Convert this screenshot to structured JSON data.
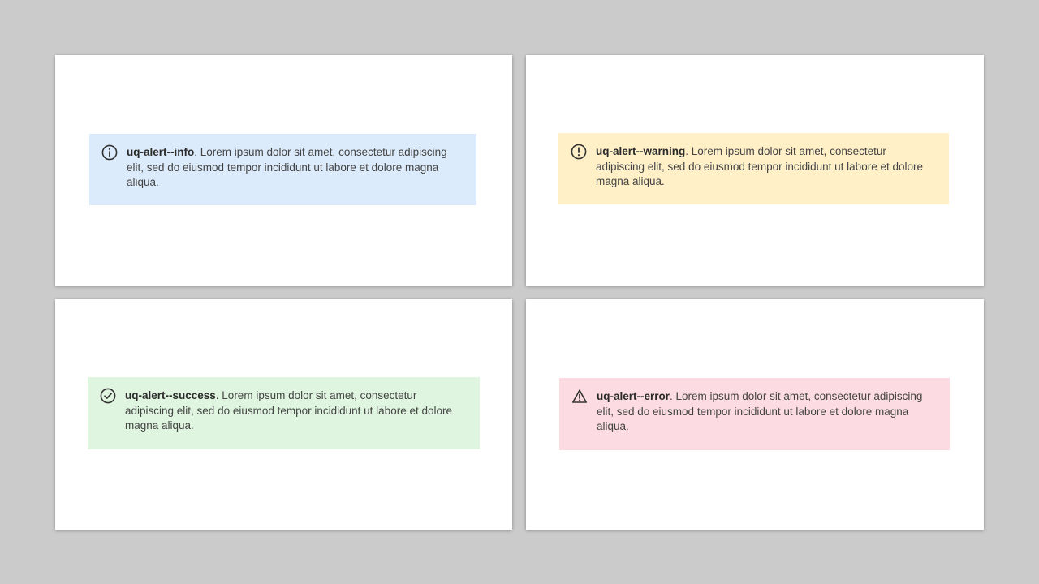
{
  "alerts": [
    {
      "title": "uq-alert--info",
      "body": ". Lorem ipsum dolor sit amet, consectetur adipiscing elit, sed do eiusmod tempor incididunt ut labore et dolore magna aliqua.",
      "icon": "info-circle-icon",
      "background": "#dcebfb"
    },
    {
      "title": "uq-alert--warning",
      "body": ". Lorem ipsum dolor sit amet, consectetur adipiscing elit, sed do eiusmod tempor incididunt ut labore et dolore magna aliqua.",
      "icon": "exclamation-circle-icon",
      "background": "#fff0c8"
    },
    {
      "title": "uq-alert--success",
      "body": ". Lorem ipsum dolor sit amet, consectetur adipiscing elit, sed do eiusmod tempor incididunt ut labore et dolore magna aliqua.",
      "icon": "check-circle-icon",
      "background": "#dff5e0"
    },
    {
      "title": "uq-alert--error",
      "body": ". Lorem ipsum dolor sit amet, consectetur adipiscing elit, sed do eiusmod tempor incididunt ut labore et dolore magna aliqua.",
      "icon": "warning-triangle-icon",
      "background": "#fcdce2"
    }
  ],
  "colors": {
    "page_background": "#cbcbcb",
    "panel_background": "#ffffff",
    "icon_stroke": "#333333",
    "text": "#444444"
  }
}
